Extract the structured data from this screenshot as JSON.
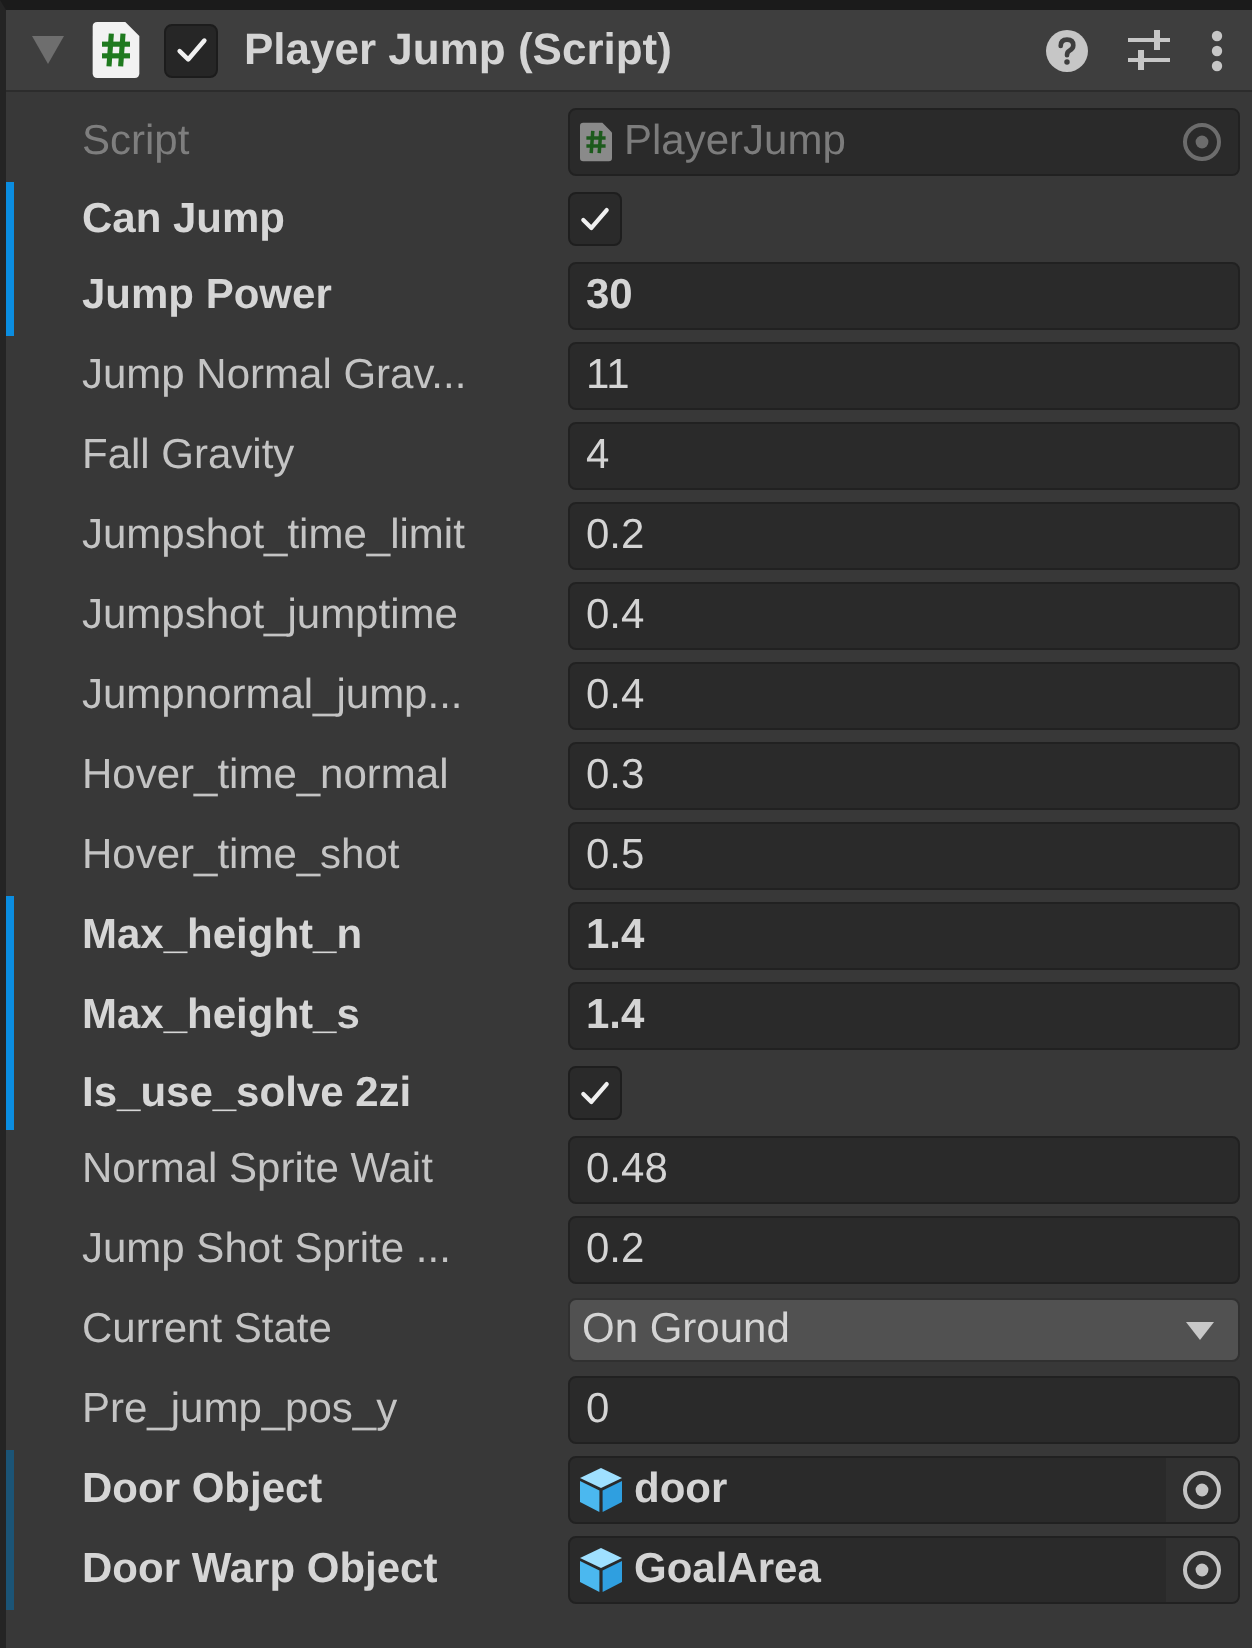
{
  "component": {
    "title": "Player Jump (Script)",
    "expanded": true,
    "enabled": true
  },
  "fields": [
    {
      "kind": "script",
      "label": "Script",
      "value": "PlayerJump",
      "modified": false
    },
    {
      "kind": "checkbox",
      "label": "Can Jump",
      "checked": true,
      "modified": true,
      "color": "#0b8de0"
    },
    {
      "kind": "number",
      "label": "Jump Power",
      "value": "30",
      "modified": true,
      "color": "#0b8de0"
    },
    {
      "kind": "number",
      "label": "Jump Normal Grav...",
      "value": "11",
      "modified": false
    },
    {
      "kind": "number",
      "label": "Fall Gravity",
      "value": "4",
      "modified": false
    },
    {
      "kind": "number",
      "label": "Jumpshot_time_limit",
      "value": "0.2",
      "modified": false
    },
    {
      "kind": "number",
      "label": "Jumpshot_jumptime",
      "value": "0.4",
      "modified": false
    },
    {
      "kind": "number",
      "label": "Jumpnormal_jump...",
      "value": "0.4",
      "modified": false
    },
    {
      "kind": "number",
      "label": "Hover_time_normal",
      "value": "0.3",
      "modified": false
    },
    {
      "kind": "number",
      "label": "Hover_time_shot",
      "value": "0.5",
      "modified": false
    },
    {
      "kind": "number",
      "label": "Max_height_n",
      "value": "1.4",
      "modified": true,
      "color": "#0b8de0"
    },
    {
      "kind": "number",
      "label": "Max_height_s",
      "value": "1.4",
      "modified": true,
      "color": "#0b8de0"
    },
    {
      "kind": "checkbox",
      "label": "Is_use_solve 2zi",
      "checked": true,
      "modified": true,
      "color": "#0b8de0"
    },
    {
      "kind": "number",
      "label": "Normal Sprite Wait",
      "value": "0.48",
      "modified": false
    },
    {
      "kind": "number",
      "label": "Jump Shot Sprite ...",
      "value": "0.2",
      "modified": false
    },
    {
      "kind": "enum",
      "label": "Current State",
      "value": "On Ground",
      "modified": false
    },
    {
      "kind": "number",
      "label": "Pre_jump_pos_y",
      "value": "0",
      "modified": false
    },
    {
      "kind": "object",
      "label": "Door Object",
      "value": "door",
      "modified": true,
      "color": "#1b5476"
    },
    {
      "kind": "object",
      "label": "Door Warp Object",
      "value": "GoalArea",
      "modified": true,
      "color": "#1b5476"
    }
  ]
}
